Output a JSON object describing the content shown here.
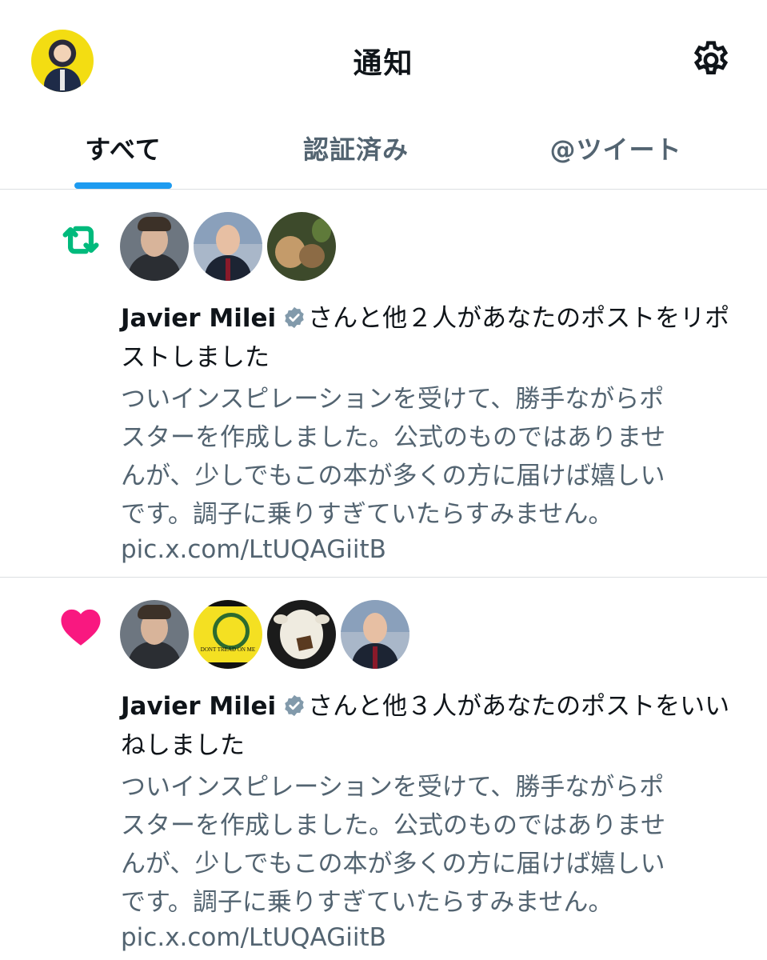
{
  "header": {
    "title": "通知",
    "avatar_icon": "user-avatar",
    "settings_icon": "gear-icon"
  },
  "tabs": [
    {
      "label": "すべて",
      "active": true
    },
    {
      "label": "認証済み",
      "active": false
    },
    {
      "label": "@ツイート",
      "active": false
    }
  ],
  "colors": {
    "accent": "#1d9bf0",
    "repost": "#00ba7c",
    "like": "#f91880",
    "verified": "#829aab",
    "secondary_text": "#536471"
  },
  "notifications": [
    {
      "type_icon": "repost-icon",
      "actor_name": "Javier Milei",
      "verified_icon": "verified-badge-icon",
      "action_text": "さんと他２人があなたのポストをリポストしました",
      "post_text": "ついインスピレーションを受けて、勝手ながらポ\nスターを作成しました。公式のものではありませ\nんが、少しでもこの本が多くの方に届けば嬉しい\nです。調子に乗りすぎていたらすみません。",
      "link": "pic.x.com/LtUQAGiitB"
    },
    {
      "type_icon": "heart-icon",
      "actor_name": "Javier Milei",
      "verified_icon": "verified-badge-icon",
      "action_text": "さんと他３人があなたのポストをいいねしました",
      "post_text": "ついインスピレーションを受けて、勝手ながらポ\nスターを作成しました。公式のものではありませ\nんが、少しでもこの本が多くの方に届けば嬉しい\nです。調子に乗りすぎていたらすみません。",
      "link": "pic.x.com/LtUQAGiitB",
      "flag_avatar_text": "DONT TREAD ON ME"
    }
  ]
}
